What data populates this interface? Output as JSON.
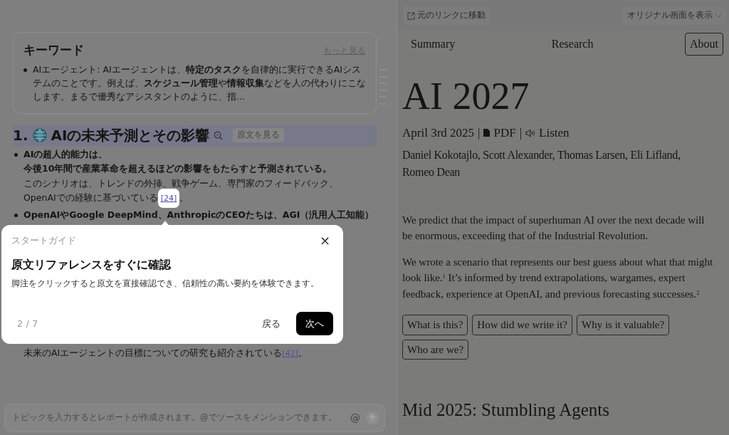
{
  "keywords": {
    "title": "キーワード",
    "more": "もっと見る",
    "items": [
      "AIエージェント: AIエージェントは、**特定のタスク**を自律的に実行できるAIシステムのことです。例えば、**スケジュール管理**や**情報収集**などを人の代わりにこなします。まるで優秀なアシスタントのように、指..."
    ]
  },
  "section": {
    "number": "1.",
    "title": "AIの未来予測とその影響",
    "source_button": "原文を見る",
    "bullets": [
      {
        "lines": [
          {
            "kind": "strong",
            "text": "AIの超人的能力は、"
          },
          {
            "kind": "strong",
            "text": "今後10年間で産業革命を超えるほどの影響をもたらすと予測されている。"
          },
          {
            "kind": "plain",
            "text": "このシナリオは、トレンドの外挿、戦争ゲーム、専門家のフィードバック、"
          },
          {
            "kind": "plain",
            "text": "OpenAIでの経験に基づいている",
            "ref": "[24]",
            "ref_highlighted": true,
            "tail": "。"
          }
        ]
      },
      {
        "lines": [
          {
            "kind": "strong",
            "text": "OpenAIやGoogle DeepMind、AnthropicのCEOたちは、AGI（汎用人工知能）"
          },
          {
            "kind": "continuation",
            "text": "未来のAIエージェントの目標についての研究も紹介されている",
            "ref": "[42]",
            "ref_highlighted": false,
            "tail": "。"
          }
        ]
      }
    ]
  },
  "input": {
    "placeholder": "トピックを入力するとレポートが作成されます。@でソースをメンションできます。",
    "mention": "@"
  },
  "guide": {
    "label": "スタートガイド",
    "close": "×",
    "title": "原文リファレンスをすぐに確認",
    "body": "脚注をクリックすると原文を直接確認でき、信頼性の高い要約を体験できます。",
    "step": "2 / 7",
    "back": "戻る",
    "next": "次へ"
  },
  "viewer": {
    "open_link": "元のリンクに移動",
    "view_original": "オリジナル画面を表示"
  },
  "site_nav": [
    {
      "label": "Summary",
      "selected": false
    },
    {
      "label": "Research",
      "selected": false
    },
    {
      "label": "About",
      "selected": true
    }
  ],
  "article": {
    "title": "AI 2027",
    "date": "April 3rd 2025",
    "separator": "|",
    "pdf": "PDF",
    "listen": "Listen",
    "authors": "Daniel Kokotajlo, Scott Alexander, Thomas Larsen, Eli Lifland, Romeo Dean",
    "paragraphs": [
      "We predict that the impact of superhuman AI over the next decade will be enormous, exceeding that of the Industrial Revolution.",
      "We wrote a scenario that represents our best guess about what that might look like.$^{1}$ It’s informed by trend extrapolations, wargames, expert feedback, experience at OpenAI, and previous forecasting successes.$^{2}$"
    ],
    "buttons": [
      "What is this?",
      "How did we write it?",
      "Why is it valuable?",
      "Who are we?"
    ],
    "heading": "Mid 2025: Stumbling Agents"
  }
}
